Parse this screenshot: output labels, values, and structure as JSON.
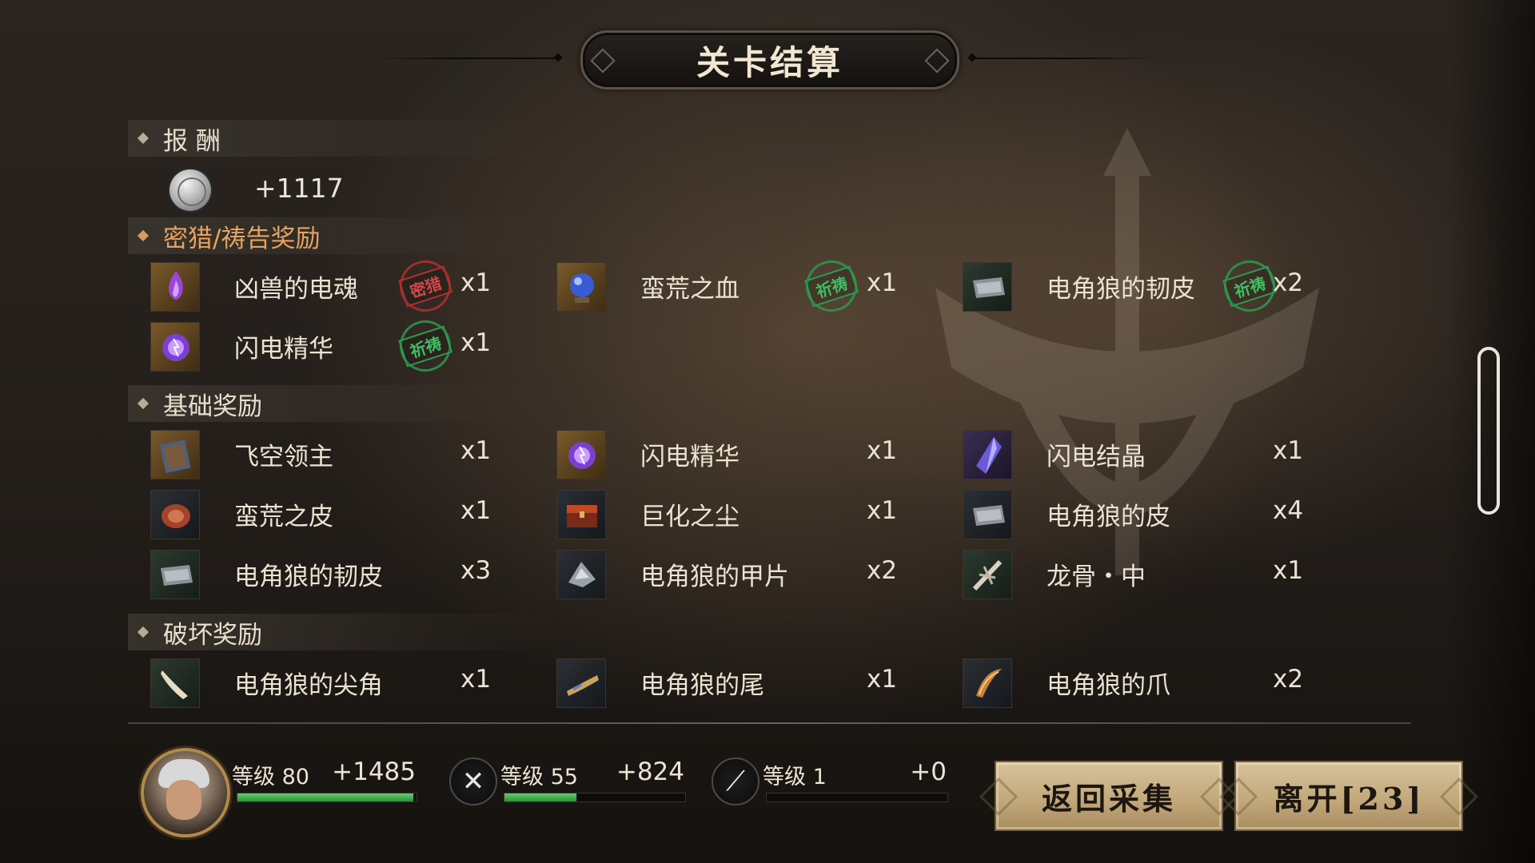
{
  "title": "关卡结算",
  "reward": {
    "header": "报 酬",
    "currency_amount": "+1117",
    "currency_icon": "silver-coin-icon"
  },
  "hunt": {
    "header": "密猎/祷告奖励",
    "items": [
      {
        "name": "凶兽的电魂",
        "qty": "x1",
        "stamp": "密猎",
        "stamp_color": "#b03030",
        "icon": "purple-flame-icon"
      },
      {
        "name": "蛮荒之血",
        "qty": "x1",
        "stamp": "祈祷",
        "stamp_color": "#2e9a4e",
        "icon": "blue-orb-icon"
      },
      {
        "name": "电角狼的韧皮",
        "qty": "x2",
        "stamp": "祈祷",
        "stamp_color": "#2e9a4e",
        "icon": "hide-icon"
      },
      {
        "name": "闪电精华",
        "qty": "x1",
        "stamp": "祈祷",
        "stamp_color": "#2e9a4e",
        "icon": "lightning-orb-icon"
      }
    ]
  },
  "basic": {
    "header": "基础奖励",
    "items": [
      {
        "name": "飞空领主",
        "qty": "x1",
        "icon": "book-icon"
      },
      {
        "name": "闪电精华",
        "qty": "x1",
        "icon": "lightning-orb-icon"
      },
      {
        "name": "闪电结晶",
        "qty": "x1",
        "icon": "crystal-icon"
      },
      {
        "name": "蛮荒之皮",
        "qty": "x1",
        "icon": "fur-icon"
      },
      {
        "name": "巨化之尘",
        "qty": "x1",
        "icon": "chest-icon"
      },
      {
        "name": "电角狼的皮",
        "qty": "x4",
        "icon": "hide-icon"
      },
      {
        "name": "电角狼的韧皮",
        "qty": "x3",
        "icon": "hide-icon"
      },
      {
        "name": "电角狼的甲片",
        "qty": "x2",
        "icon": "scale-icon"
      },
      {
        "name": "龙骨・中",
        "qty": "x1",
        "icon": "bone-icon"
      }
    ]
  },
  "break": {
    "header": "破坏奖励",
    "items": [
      {
        "name": "电角狼的尖角",
        "qty": "x1",
        "icon": "horn-icon"
      },
      {
        "name": "电角狼的尾",
        "qty": "x1",
        "icon": "tail-icon"
      },
      {
        "name": "电角狼的爪",
        "qty": "x2",
        "icon": "claw-icon"
      }
    ]
  },
  "status": {
    "player": {
      "label": "等级 80",
      "gain": "+1485",
      "progress": 0.98
    },
    "weapon1": {
      "label": "等级 55",
      "gain": "+824",
      "progress": 0.4
    },
    "weapon2": {
      "label": "等级 1",
      "gain": "+0",
      "progress": 0.0
    }
  },
  "buttons": {
    "return": "返回采集",
    "leave": "离开[23]"
  },
  "colors": {
    "accent_orange": "#e6a25f",
    "button_gold": "#c3a97c",
    "progress_green": "#4fbf5a"
  }
}
